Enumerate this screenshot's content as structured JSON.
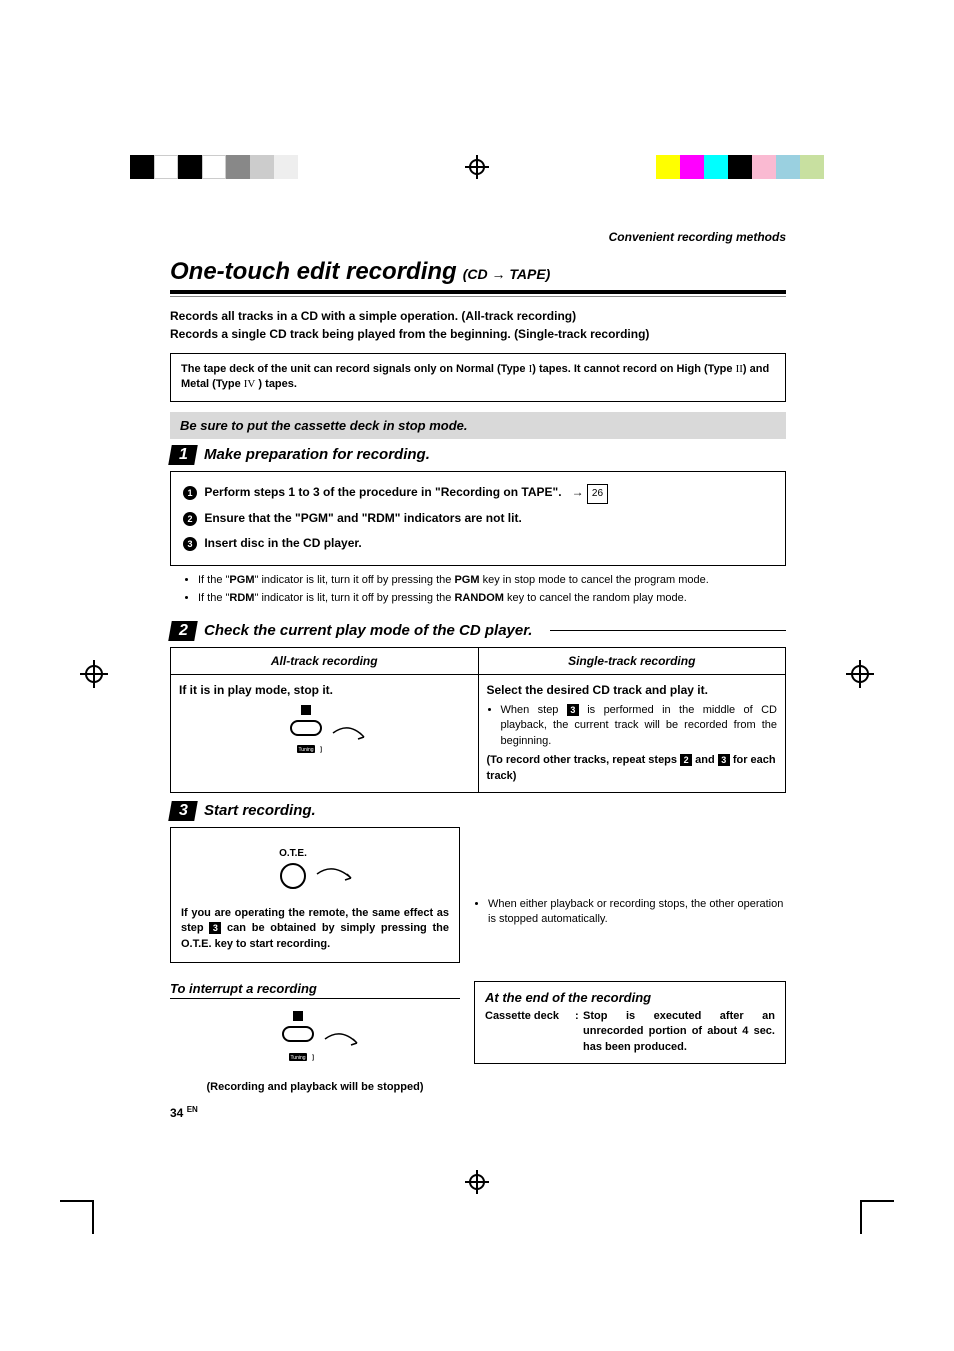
{
  "header": "Convenient recording methods",
  "title": "One-touch edit recording",
  "title_sub_pre": "(CD",
  "title_sub_post": "TAPE)",
  "intro_l1": "Records all tracks in a CD with a simple operation. (All-track recording)",
  "intro_l2": "Records a single CD track being played from the beginning. (Single-track recording)",
  "note_p1": "The tape deck of the unit can record signals only on Normal (Type ",
  "note_r1": "I",
  "note_p2": ") tapes. It cannot record on High (Type ",
  "note_r2": "II",
  "note_p3": ") and Metal (Type ",
  "note_r3": "IV",
  "note_p4": " ) tapes.",
  "sure": "Be sure to put the cassette deck in stop mode.",
  "steps": {
    "s1": {
      "num": "1",
      "title": "Make preparation for recording."
    },
    "s2": {
      "num": "2",
      "title": "Check the current play mode of the CD player."
    },
    "s3": {
      "num": "3",
      "title": "Start recording."
    }
  },
  "proc": {
    "n1": "1",
    "t1a": "Perform steps 1 to 3 of the procedure in \"Recording on TAPE\".",
    "ref": "26",
    "n2": "2",
    "t2": "Ensure that the \"PGM\" and \"RDM\" indicators are not lit.",
    "n3": "3",
    "t3": "Insert disc in the CD player."
  },
  "bul1_a": "If the \"",
  "bul1_b": "PGM",
  "bul1_c": "\" indicator is lit, turn it off by pressing the ",
  "bul1_d": "PGM",
  "bul1_e": " key in stop mode to cancel the program mode.",
  "bul2_a": "If the \"",
  "bul2_b": "RDM",
  "bul2_c": "\" indicator is lit, turn it off by pressing the ",
  "bul2_d": "RANDOM",
  "bul2_e": " key to cancel the random play mode.",
  "table": {
    "h1": "All-track recording",
    "h2": "Single-track recording",
    "c1_head": "If it is in play mode, stop it.",
    "c2_head": "Select the desired CD track and play it.",
    "c2_b1a": "When step ",
    "c2_b1b": " is performed in the middle of CD playback, the current track will be recorded from the beginning.",
    "c2_b2a": "(To record other tracks, repeat steps ",
    "c2_b2b": " and ",
    "c2_b2c": " for each track)",
    "inv2": "2",
    "inv3": "3"
  },
  "ote_label": "O.T.E.",
  "step3_box": "If you are operating the remote, the same effect as step 3 can be obtained by simply pressing the O.T.E. key to start recording.",
  "step3_box_a": "If you are operating the remote, the same effect as step ",
  "step3_box_b": " can be obtained by simply pressing the O.T.E. key to start recording.",
  "step3_right": "When either playback or recording stops, the other operation is stopped automatically.",
  "interrupt": {
    "title": "To interrupt a recording",
    "cap": "(Recording and playback will be stopped)"
  },
  "end": {
    "title": "At the end of the recording",
    "label": "Cassette deck",
    "colon": ":",
    "text": "Stop is executed after an unrecorded portion of about 4 sec. has been produced."
  },
  "pagenum": "34",
  "pagelang": "EN",
  "tuning_label": "Tuning Mode"
}
